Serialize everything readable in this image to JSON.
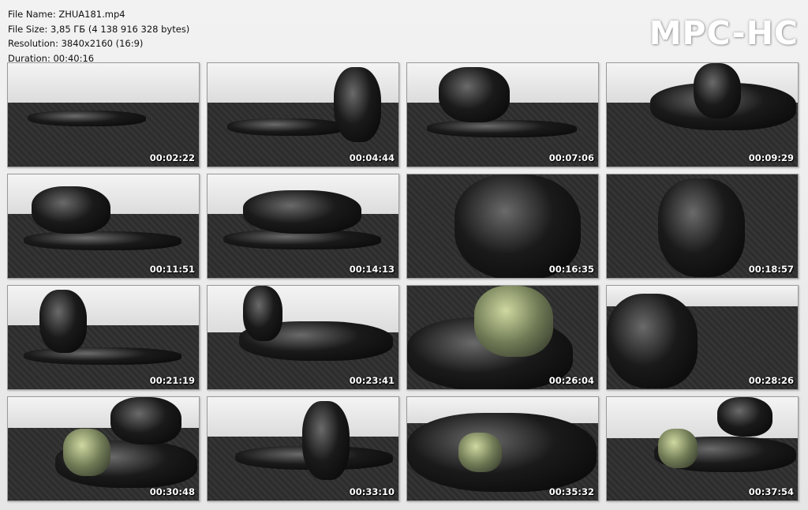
{
  "file_info": {
    "name": "File Name: ZHUA181.mp4",
    "size": "File Size: 3,85 ГБ (4 138 916 328 bytes)",
    "resolution": "Resolution: 3840x2160 (16:9)",
    "duration": "Duration: 00:40:16"
  },
  "logo": "MPC-HC",
  "thumbnails": [
    {
      "time": "00:02:22"
    },
    {
      "time": "00:04:44"
    },
    {
      "time": "00:07:06"
    },
    {
      "time": "00:09:29"
    },
    {
      "time": "00:11:51"
    },
    {
      "time": "00:14:13"
    },
    {
      "time": "00:16:35"
    },
    {
      "time": "00:18:57"
    },
    {
      "time": "00:21:19"
    },
    {
      "time": "00:23:41"
    },
    {
      "time": "00:26:04"
    },
    {
      "time": "00:28:26"
    },
    {
      "time": "00:30:48"
    },
    {
      "time": "00:33:10"
    },
    {
      "time": "00:35:32"
    },
    {
      "time": "00:37:54"
    }
  ]
}
